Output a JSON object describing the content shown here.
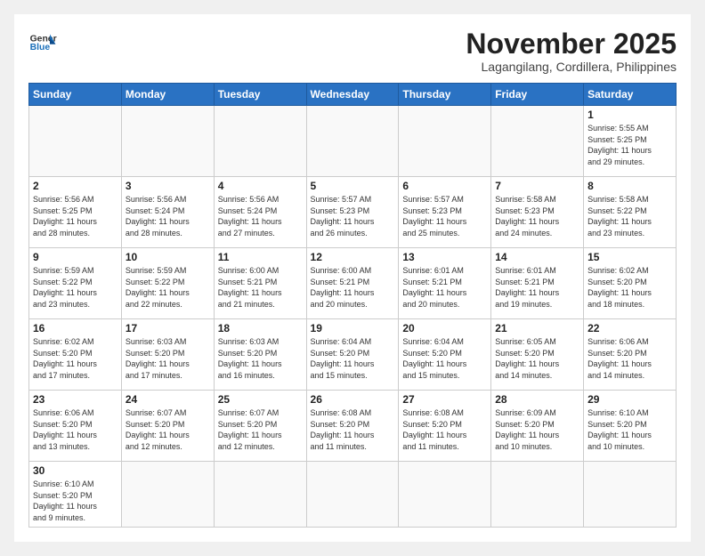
{
  "header": {
    "logo_general": "General",
    "logo_blue": "Blue",
    "month_title": "November 2025",
    "subtitle": "Lagangilang, Cordillera, Philippines"
  },
  "weekdays": [
    "Sunday",
    "Monday",
    "Tuesday",
    "Wednesday",
    "Thursday",
    "Friday",
    "Saturday"
  ],
  "weeks": [
    [
      {
        "day": "",
        "info": ""
      },
      {
        "day": "",
        "info": ""
      },
      {
        "day": "",
        "info": ""
      },
      {
        "day": "",
        "info": ""
      },
      {
        "day": "",
        "info": ""
      },
      {
        "day": "",
        "info": ""
      },
      {
        "day": "1",
        "info": "Sunrise: 5:55 AM\nSunset: 5:25 PM\nDaylight: 11 hours\nand 29 minutes."
      }
    ],
    [
      {
        "day": "2",
        "info": "Sunrise: 5:56 AM\nSunset: 5:25 PM\nDaylight: 11 hours\nand 28 minutes."
      },
      {
        "day": "3",
        "info": "Sunrise: 5:56 AM\nSunset: 5:24 PM\nDaylight: 11 hours\nand 28 minutes."
      },
      {
        "day": "4",
        "info": "Sunrise: 5:56 AM\nSunset: 5:24 PM\nDaylight: 11 hours\nand 27 minutes."
      },
      {
        "day": "5",
        "info": "Sunrise: 5:57 AM\nSunset: 5:23 PM\nDaylight: 11 hours\nand 26 minutes."
      },
      {
        "day": "6",
        "info": "Sunrise: 5:57 AM\nSunset: 5:23 PM\nDaylight: 11 hours\nand 25 minutes."
      },
      {
        "day": "7",
        "info": "Sunrise: 5:58 AM\nSunset: 5:23 PM\nDaylight: 11 hours\nand 24 minutes."
      },
      {
        "day": "8",
        "info": "Sunrise: 5:58 AM\nSunset: 5:22 PM\nDaylight: 11 hours\nand 23 minutes."
      }
    ],
    [
      {
        "day": "9",
        "info": "Sunrise: 5:59 AM\nSunset: 5:22 PM\nDaylight: 11 hours\nand 23 minutes."
      },
      {
        "day": "10",
        "info": "Sunrise: 5:59 AM\nSunset: 5:22 PM\nDaylight: 11 hours\nand 22 minutes."
      },
      {
        "day": "11",
        "info": "Sunrise: 6:00 AM\nSunset: 5:21 PM\nDaylight: 11 hours\nand 21 minutes."
      },
      {
        "day": "12",
        "info": "Sunrise: 6:00 AM\nSunset: 5:21 PM\nDaylight: 11 hours\nand 20 minutes."
      },
      {
        "day": "13",
        "info": "Sunrise: 6:01 AM\nSunset: 5:21 PM\nDaylight: 11 hours\nand 20 minutes."
      },
      {
        "day": "14",
        "info": "Sunrise: 6:01 AM\nSunset: 5:21 PM\nDaylight: 11 hours\nand 19 minutes."
      },
      {
        "day": "15",
        "info": "Sunrise: 6:02 AM\nSunset: 5:20 PM\nDaylight: 11 hours\nand 18 minutes."
      }
    ],
    [
      {
        "day": "16",
        "info": "Sunrise: 6:02 AM\nSunset: 5:20 PM\nDaylight: 11 hours\nand 17 minutes."
      },
      {
        "day": "17",
        "info": "Sunrise: 6:03 AM\nSunset: 5:20 PM\nDaylight: 11 hours\nand 17 minutes."
      },
      {
        "day": "18",
        "info": "Sunrise: 6:03 AM\nSunset: 5:20 PM\nDaylight: 11 hours\nand 16 minutes."
      },
      {
        "day": "19",
        "info": "Sunrise: 6:04 AM\nSunset: 5:20 PM\nDaylight: 11 hours\nand 15 minutes."
      },
      {
        "day": "20",
        "info": "Sunrise: 6:04 AM\nSunset: 5:20 PM\nDaylight: 11 hours\nand 15 minutes."
      },
      {
        "day": "21",
        "info": "Sunrise: 6:05 AM\nSunset: 5:20 PM\nDaylight: 11 hours\nand 14 minutes."
      },
      {
        "day": "22",
        "info": "Sunrise: 6:06 AM\nSunset: 5:20 PM\nDaylight: 11 hours\nand 14 minutes."
      }
    ],
    [
      {
        "day": "23",
        "info": "Sunrise: 6:06 AM\nSunset: 5:20 PM\nDaylight: 11 hours\nand 13 minutes."
      },
      {
        "day": "24",
        "info": "Sunrise: 6:07 AM\nSunset: 5:20 PM\nDaylight: 11 hours\nand 12 minutes."
      },
      {
        "day": "25",
        "info": "Sunrise: 6:07 AM\nSunset: 5:20 PM\nDaylight: 11 hours\nand 12 minutes."
      },
      {
        "day": "26",
        "info": "Sunrise: 6:08 AM\nSunset: 5:20 PM\nDaylight: 11 hours\nand 11 minutes."
      },
      {
        "day": "27",
        "info": "Sunrise: 6:08 AM\nSunset: 5:20 PM\nDaylight: 11 hours\nand 11 minutes."
      },
      {
        "day": "28",
        "info": "Sunrise: 6:09 AM\nSunset: 5:20 PM\nDaylight: 11 hours\nand 10 minutes."
      },
      {
        "day": "29",
        "info": "Sunrise: 6:10 AM\nSunset: 5:20 PM\nDaylight: 11 hours\nand 10 minutes."
      }
    ],
    [
      {
        "day": "30",
        "info": "Sunrise: 6:10 AM\nSunset: 5:20 PM\nDaylight: 11 hours\nand 9 minutes."
      },
      {
        "day": "",
        "info": ""
      },
      {
        "day": "",
        "info": ""
      },
      {
        "day": "",
        "info": ""
      },
      {
        "day": "",
        "info": ""
      },
      {
        "day": "",
        "info": ""
      },
      {
        "day": "",
        "info": ""
      }
    ]
  ]
}
